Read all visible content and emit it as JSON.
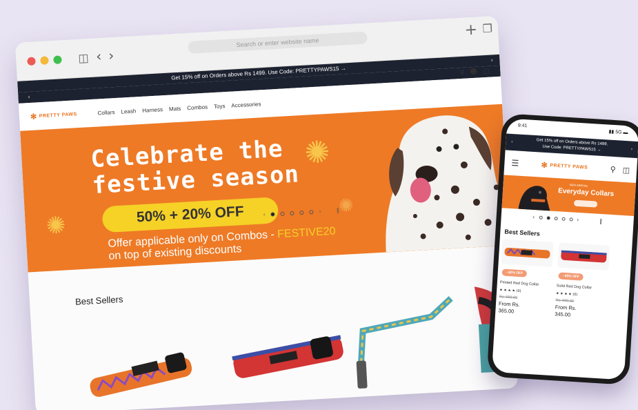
{
  "browser": {
    "url_placeholder": "Search or enter website name",
    "nav_icons": {
      "back": "chevron-left-icon",
      "forward": "chevron-right-icon",
      "new_tab": "plus-icon",
      "tabs": "tabs-icon",
      "sidebar": "sidebar-icon"
    }
  },
  "site": {
    "promo": "Get 15% off on Orders above Rs 1499. Use Code: PRETTYPAWS15 →",
    "logo": "PRETTY PAWS",
    "menu": [
      "Collars",
      "Leash",
      "Harness",
      "Mats",
      "Combos",
      "Toys",
      "Accessories"
    ],
    "icons": [
      "search-icon",
      "account-icon",
      "cart-icon"
    ]
  },
  "hero": {
    "headline_line1": "Celebrate the",
    "headline_line2": "festive season",
    "discount": "50% + 20% OFF",
    "offer_line1": "Offer applicable only on Combos - ",
    "offer_code": "FESTIVE20",
    "offer_line2": "on top of existing discounts",
    "slides": 5,
    "active_slide": 1
  },
  "best_sellers": {
    "title": "Best Sellers"
  },
  "phone": {
    "status_left": "9:41",
    "status_right": "▮▮ 5G ▬",
    "promo_line1": "Get 15% off on Orders above Rs 1499.",
    "promo_line2": "Use Code: PRETTYPAWS15 →",
    "logo": "PRETTY PAWS",
    "hero_kicker": "NEW ARRIVAL",
    "hero_title": "Everyday Collars",
    "best_title": "Best Sellers",
    "products": [
      {
        "badge": "- 62% OFF",
        "name": "Printed Red Dog Collar",
        "stars": "★ ★ ★ ★  (0)",
        "old": "Rs. 999.00",
        "price_line1": "From Rs.",
        "price_line2": "365.00"
      },
      {
        "badge": "- 65% OFF",
        "name": "Solid Red Dog Collar",
        "stars": "★ ★ ★ ★  (0)",
        "old": "Rs. 999.00",
        "price_line1": "From Rs.",
        "price_line2": "345.00"
      }
    ]
  }
}
